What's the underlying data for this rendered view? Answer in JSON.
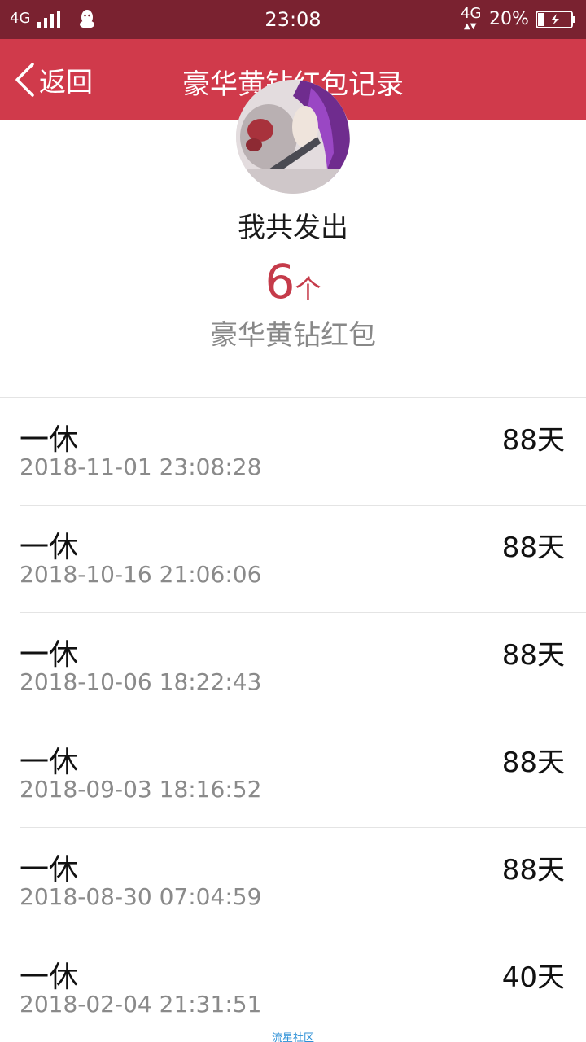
{
  "status_bar": {
    "signal_label": "4G",
    "time": "23:08",
    "network": "4G",
    "network_arrows": "▲▼",
    "battery_percent": "20%",
    "battery_level": 0.2
  },
  "nav": {
    "back_label": "返回",
    "title": "豪华黄钻红包记录"
  },
  "summary": {
    "label": "我共发出",
    "count": "6",
    "count_unit": "个",
    "type_label": "豪华黄钻红包"
  },
  "records": [
    {
      "name": "一休",
      "time": "2018-11-01 23:08:28",
      "amount": "88天"
    },
    {
      "name": "一休",
      "time": "2018-10-16 21:06:06",
      "amount": "88天"
    },
    {
      "name": "一休",
      "time": "2018-10-06 18:22:43",
      "amount": "88天"
    },
    {
      "name": "一休",
      "time": "2018-09-03 18:16:52",
      "amount": "88天"
    },
    {
      "name": "一休",
      "time": "2018-08-30 07:04:59",
      "amount": "88天"
    },
    {
      "name": "一休",
      "time": "2018-02-04 21:31:51",
      "amount": "40天"
    }
  ],
  "watermark": "流星社区",
  "colors": {
    "status_bar_bg": "#7a2230",
    "nav_bg": "#d03a4b",
    "accent_count": "#c53b4a",
    "watermark": "#2c8fd6"
  },
  "icons": {
    "back": "chevron-left-icon",
    "qq": "qq-penguin-icon",
    "signal": "signal-bars-icon",
    "battery": "battery-charging-icon"
  }
}
